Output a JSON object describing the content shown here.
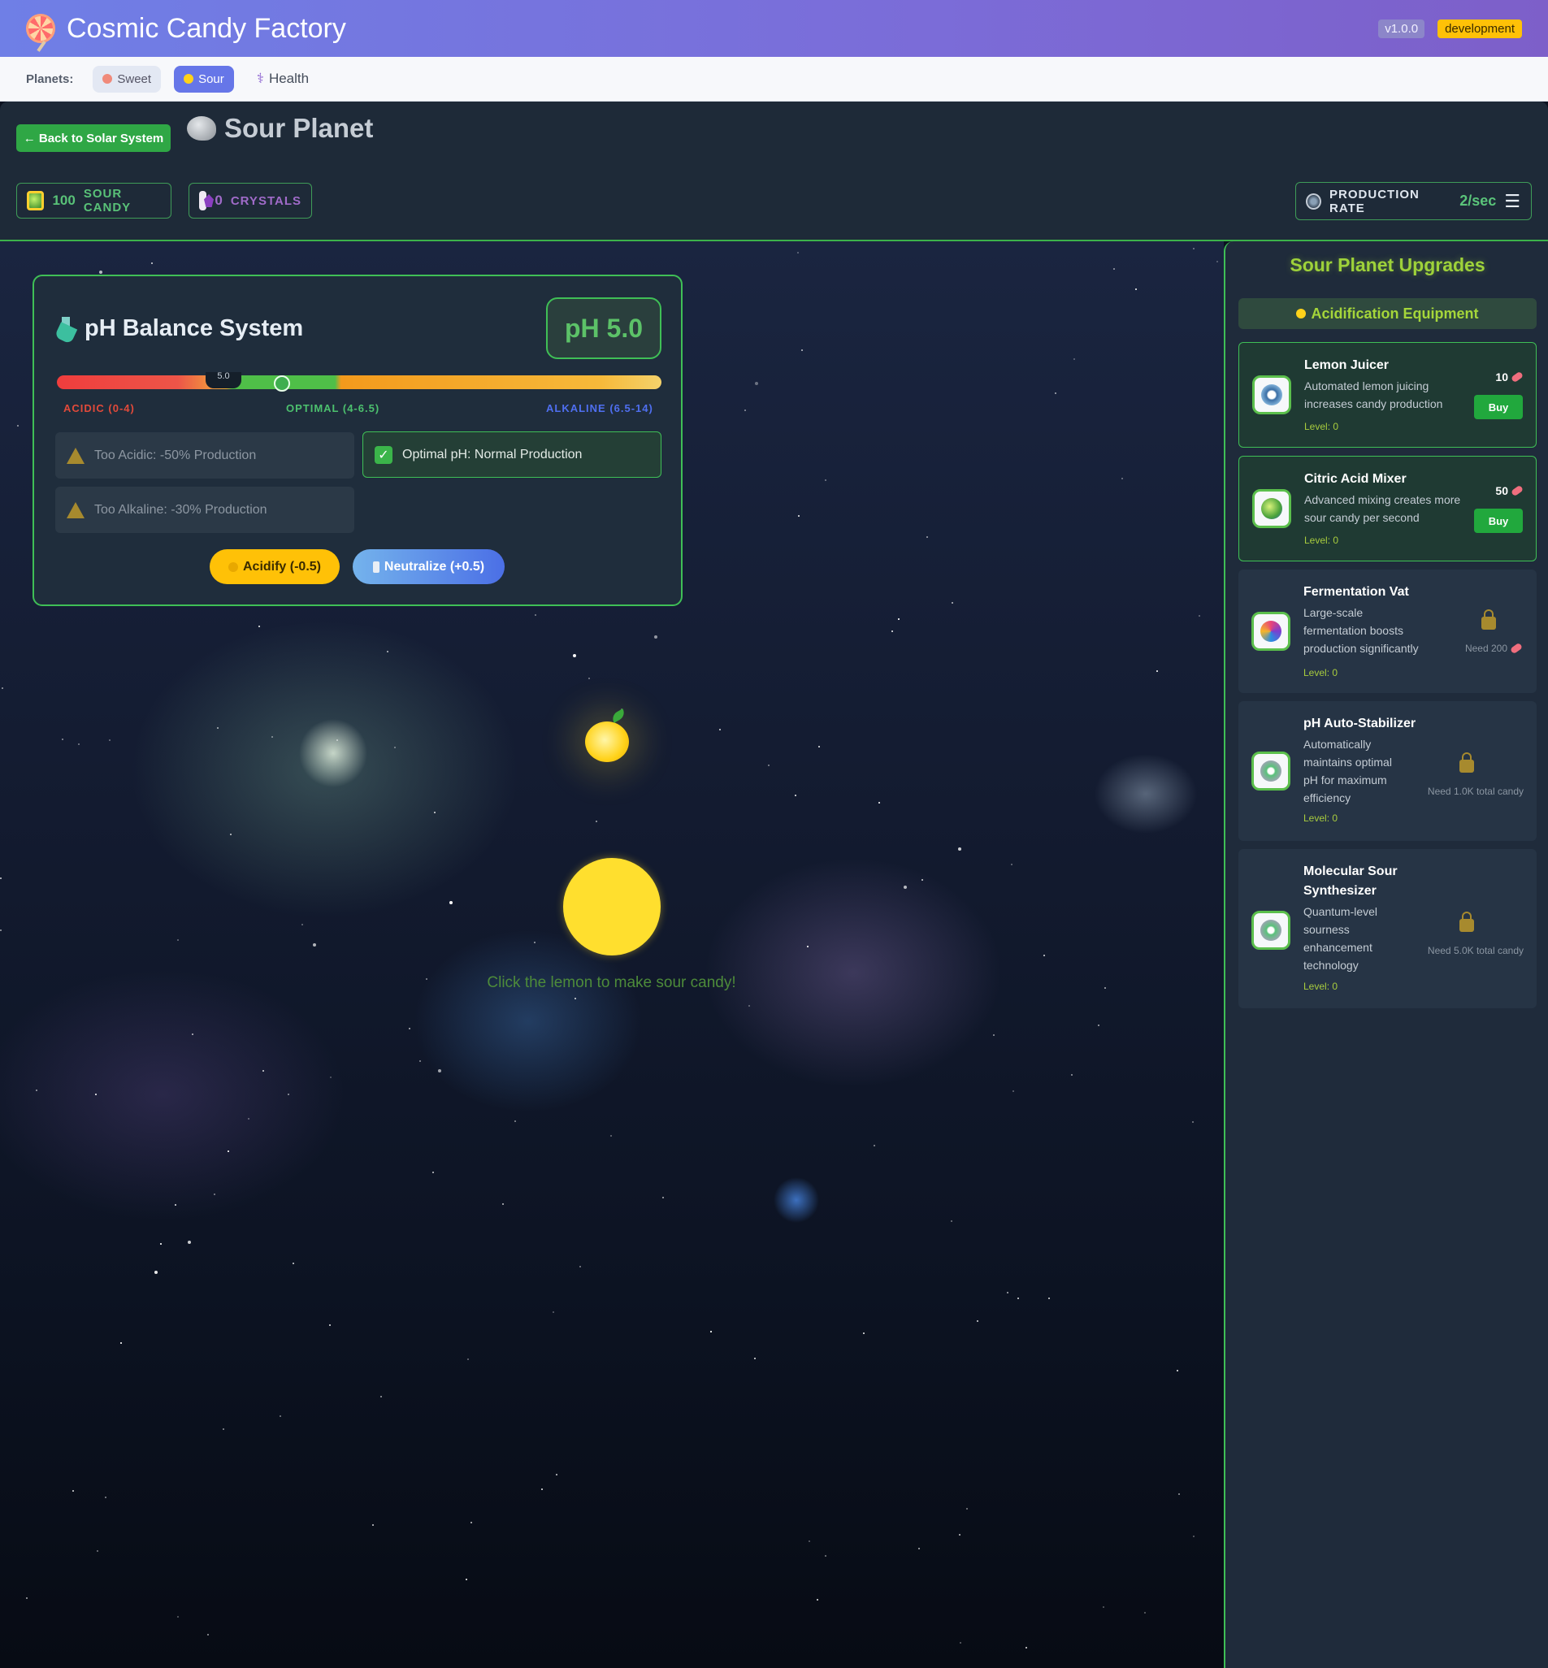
{
  "app": {
    "title": "Cosmic Candy Factory",
    "version": "v1.0.0",
    "env": "development"
  },
  "planets": {
    "label": "Planets:",
    "sweet": "Sweet",
    "sour": "Sour",
    "health": "Health"
  },
  "planet": {
    "back": "← Back to Solar System",
    "title": "Sour Planet"
  },
  "resources": {
    "candy_value": "100",
    "candy_label": "SOUR CANDY",
    "crystals_value": "0",
    "crystals_label": "CRYSTALS"
  },
  "production": {
    "label": "PRODUCTION RATE",
    "value": "2/sec"
  },
  "ph": {
    "title": "pH Balance System",
    "display": "pH 5.0",
    "marker": "5.0",
    "acidic_label": "ACIDIC (0-4)",
    "optimal_label": "OPTIMAL (4-6.5)",
    "alkaline_label": "ALKALINE (6.5-14)",
    "too_acidic": "Too Acidic: -50% Production",
    "optimal": "Optimal pH: Normal Production",
    "too_alkaline": "Too Alkaline: -30% Production",
    "acidify": "Acidify (-0.5)",
    "neutralize": "Neutralize (+0.5)",
    "value": 5.0
  },
  "hint": "Click the lemon to make sour candy!",
  "upgrades": {
    "title": "Sour Planet Upgrades",
    "category": "Acidification Equipment",
    "buy_label": "Buy",
    "items": [
      {
        "name": "Lemon Juicer",
        "desc": "Automated lemon juicing increases candy production",
        "level": "Level: 0",
        "cost": "10",
        "state": "available",
        "icon": "gear-icon"
      },
      {
        "name": "Citric Acid Mixer",
        "desc": "Advanced mixing creates more sour candy per second",
        "level": "Level: 0",
        "cost": "50",
        "state": "available",
        "icon": "mixer-icon"
      },
      {
        "name": "Fermentation Vat",
        "desc": "Large-scale fermentation boosts production significantly",
        "level": "Level: 0",
        "need": "Need 200",
        "state": "locked",
        "icon": "swirl-icon"
      },
      {
        "name": "pH Auto-Stabilizer",
        "desc": "Automatically maintains optimal pH for maximum efficiency",
        "level": "Level: 0",
        "need": "Need 1.0K total candy",
        "state": "locked",
        "icon": "sparkle-icon"
      },
      {
        "name": "Molecular Sour Synthesizer",
        "desc": "Quantum-level sourness enhancement technology",
        "level": "Level: 0",
        "need": "Need 5.0K total candy",
        "state": "locked",
        "icon": "sparkle-icon"
      }
    ]
  },
  "colors": {
    "accent_green": "#3fbf56",
    "header_start": "#6f7fe6",
    "header_end": "#7d5fc9",
    "lemon": "#ffdf2e"
  }
}
